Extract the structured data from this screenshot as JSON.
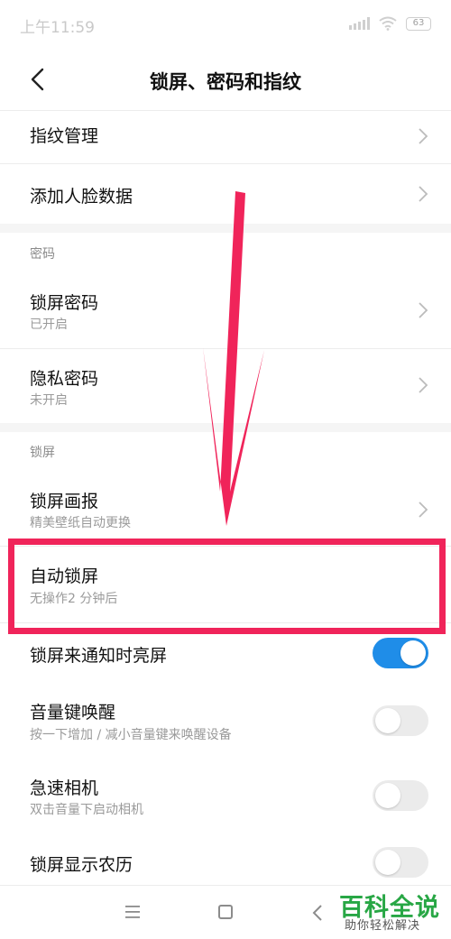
{
  "status_bar": {
    "time": "上午11:59",
    "battery": "63",
    "icons": [
      "signal-icon",
      "wifi-icon",
      "battery-icon"
    ]
  },
  "header": {
    "title": "锁屏、密码和指纹",
    "back_icon": "back-chevron-icon"
  },
  "sections": {
    "top_items": [
      {
        "label": "指纹管理"
      },
      {
        "label": "添加人脸数据"
      }
    ],
    "password": {
      "header": "密码",
      "items": [
        {
          "label": "锁屏密码",
          "sub": "已开启"
        },
        {
          "label": "隐私密码",
          "sub": "未开启"
        }
      ]
    },
    "lockscreen": {
      "header": "锁屏",
      "items": [
        {
          "label": "锁屏画报",
          "sub": "精美壁纸自动更换"
        },
        {
          "label": "自动锁屏",
          "sub": "无操作2 分钟后"
        },
        {
          "label": "锁屏来通知时亮屏",
          "toggle": true
        },
        {
          "label": "音量键唤醒",
          "sub": "按一下增加 / 减小音量键来唤醒设备",
          "toggle": false
        },
        {
          "label": "急速相机",
          "sub": "双击音量下启动相机",
          "toggle": false
        },
        {
          "label": "锁屏显示农历",
          "toggle": false
        }
      ]
    }
  },
  "annotation": {
    "arrow_color": "#f0245a",
    "box_color": "#f0245a"
  },
  "nav": {
    "icons": [
      "menu-icon",
      "home-icon",
      "back-icon"
    ]
  },
  "watermark": {
    "title": "百科全说",
    "subtitle": "助你轻松解决"
  },
  "colors": {
    "accent": "#1f8de8",
    "toggle_off": "#ebebeb",
    "watermark_green": "#28a745"
  }
}
